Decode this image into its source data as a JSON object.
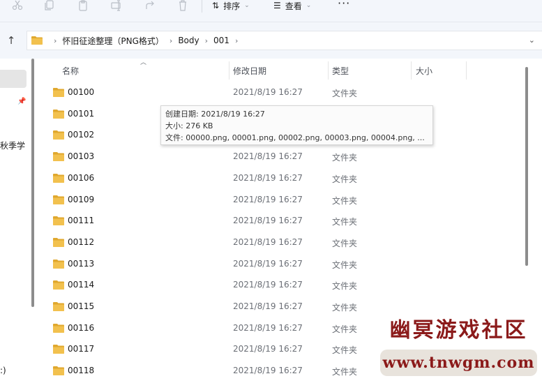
{
  "toolbar": {
    "icons": [
      "cut-icon",
      "copy-icon",
      "paste-icon",
      "rename-icon",
      "share-icon",
      "delete-icon"
    ],
    "sort_label": "排序",
    "view_label": "查看",
    "more_label": "···"
  },
  "breadcrumb": {
    "items": [
      "怀旧征途整理（PNG格式）",
      "Body",
      "001"
    ]
  },
  "nav": {
    "partial_label_1": "秋季学",
    "partial_label_2": ":)"
  },
  "columns": {
    "name": "名称",
    "date": "修改日期",
    "type": "类型",
    "size": "大小"
  },
  "rows": [
    {
      "name": "00100",
      "date": "2021/8/19 16:27",
      "type": "文件夹"
    },
    {
      "name": "00101",
      "date": "",
      "type": ""
    },
    {
      "name": "00102",
      "date": "",
      "type": ""
    },
    {
      "name": "00103",
      "date": "2021/8/19 16:27",
      "type": "文件夹"
    },
    {
      "name": "00106",
      "date": "2021/8/19 16:27",
      "type": "文件夹"
    },
    {
      "name": "00109",
      "date": "2021/8/19 16:27",
      "type": "文件夹"
    },
    {
      "name": "00111",
      "date": "2021/8/19 16:27",
      "type": "文件夹"
    },
    {
      "name": "00112",
      "date": "2021/8/19 16:27",
      "type": "文件夹"
    },
    {
      "name": "00113",
      "date": "2021/8/19 16:27",
      "type": "文件夹"
    },
    {
      "name": "00114",
      "date": "2021/8/19 16:27",
      "type": "文件夹"
    },
    {
      "name": "00115",
      "date": "2021/8/19 16:27",
      "type": "文件夹"
    },
    {
      "name": "00116",
      "date": "2021/8/19 16:27",
      "type": "文件夹"
    },
    {
      "name": "00117",
      "date": "2021/8/19 16:27",
      "type": "文件夹"
    },
    {
      "name": "00118",
      "date": "2021/8/19 16:27",
      "type": "文件夹"
    }
  ],
  "tooltip": {
    "created": "创建日期: 2021/8/19 16:27",
    "size": "大小: 276 KB",
    "files": "文件: 00000.png, 00001.png, 00002.png, 00003.png, 00004.png, ..."
  },
  "watermark": {
    "title": "幽冥游戏社区",
    "url": "www.tnwgm.com"
  },
  "colors": {
    "folder": "#f2c14e",
    "folder_dark": "#e0a82e",
    "accent": "#0067c0",
    "watermark_text": "#8b1a1a"
  }
}
